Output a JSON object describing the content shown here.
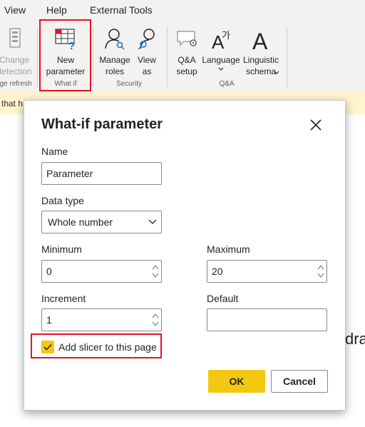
{
  "menu": {
    "view": "View",
    "help": "Help",
    "external_tools": "External Tools"
  },
  "ribbon": {
    "change_detection": "Change\ndetection",
    "page_refresh_group": "ge refresh",
    "new_parameter": "New\nparameter",
    "what_if_group": "What if",
    "manage_roles": "Manage\nroles",
    "view_as": "View\nas",
    "security_group": "Security",
    "qa_setup": "Q&A\nsetup",
    "language": "Language",
    "linguistic_schema": "Linguistic\nschema",
    "qa_group": "Q&A"
  },
  "notification": {
    "text": "that h"
  },
  "background_fragment": "dra",
  "dialog": {
    "title": "What-if parameter",
    "name_label": "Name",
    "name_value": "Parameter",
    "data_type_label": "Data type",
    "data_type_value": "Whole number",
    "minimum_label": "Minimum",
    "minimum_value": "0",
    "maximum_label": "Maximum",
    "maximum_value": "20",
    "increment_label": "Increment",
    "increment_value": "1",
    "default_label": "Default",
    "default_value": "",
    "add_slicer_label": "Add slicer to this page",
    "add_slicer_checked": true,
    "ok_label": "OK",
    "cancel_label": "Cancel"
  },
  "colors": {
    "accent": "#f2c811",
    "highlight": "#e81123",
    "notification_bg": "#fff4ce",
    "ribbon_bg": "#f3f2f1"
  }
}
